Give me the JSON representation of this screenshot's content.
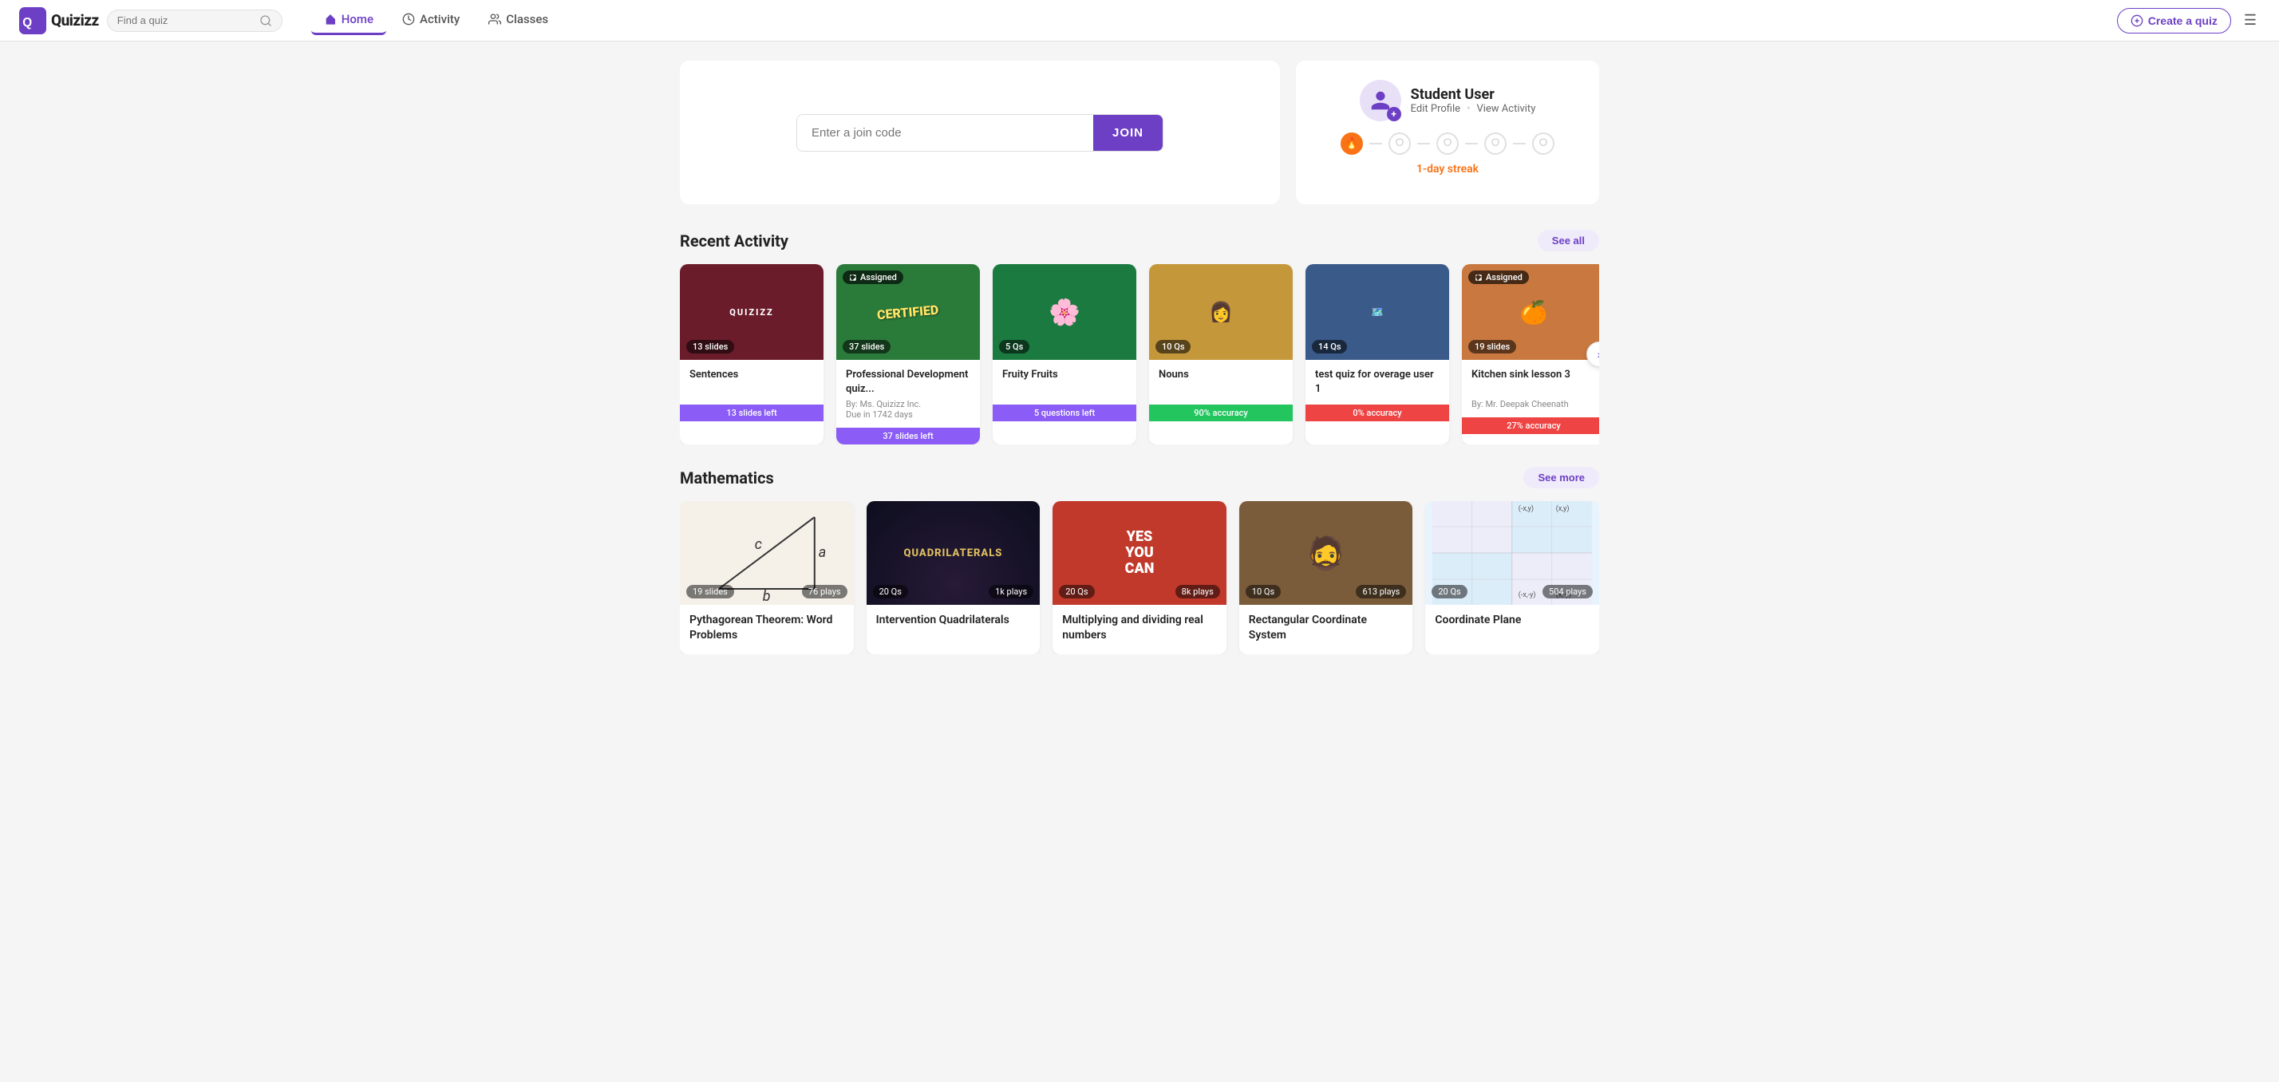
{
  "nav": {
    "logo": "Quizizz",
    "search_placeholder": "Find a quiz",
    "links": [
      {
        "id": "home",
        "label": "Home",
        "active": true,
        "icon": "home"
      },
      {
        "id": "activity",
        "label": "Activity",
        "active": false,
        "icon": "clock"
      },
      {
        "id": "classes",
        "label": "Classes",
        "active": false,
        "icon": "users"
      }
    ],
    "create_label": "Create a quiz",
    "menu_icon": "☰"
  },
  "hero": {
    "join_placeholder": "Enter a join code",
    "join_btn": "JOIN",
    "profile": {
      "name": "Student User",
      "edit_label": "Edit Profile",
      "view_label": "View Activity",
      "streak_label": "1-day streak",
      "streak_days": [
        true,
        false,
        false,
        false,
        false,
        false
      ]
    }
  },
  "recent_activity": {
    "title": "Recent Activity",
    "see_all": "See all",
    "cards": [
      {
        "id": "sentences",
        "title": "Sentences",
        "badge_left": "13 slides",
        "bg_color": "#6b1c2b",
        "text_color": "#fff",
        "logo_text": "Quizizz",
        "status_label": "13 slides left",
        "status_type": "purple"
      },
      {
        "id": "professional",
        "title": "Professional Development quiz...",
        "badge_left": "37 slides",
        "bg_color": "#2d7a3a",
        "text_color": "#fff",
        "assigned": true,
        "by": "By: Ms. Quizizz Inc.",
        "due": "Due in 1742 days",
        "status_label": "37 slides left",
        "status_type": "purple"
      },
      {
        "id": "fruity",
        "title": "Fruity Fruits",
        "badge_left": "5 Qs",
        "bg_color": "#1a7a40",
        "text_color": "#fff",
        "status_label": "5 questions left",
        "status_type": "purple"
      },
      {
        "id": "nouns",
        "title": "Nouns",
        "badge_left": "10 Qs",
        "bg_color": "#8a6a2e",
        "text_color": "#fff",
        "status_label": "90% accuracy",
        "status_type": "green"
      },
      {
        "id": "test-quiz",
        "title": "test quiz for overage user 1",
        "badge_left": "14 Qs",
        "bg_color": "#3a5a7a",
        "text_color": "#fff",
        "status_label": "0% accuracy",
        "status_type": "red"
      },
      {
        "id": "kitchen",
        "title": "Kitchen sink lesson 3",
        "badge_left": "19 slides",
        "bg_color": "#b85c1a",
        "text_color": "#fff",
        "assigned": true,
        "by": "By: Mr. Deepak Cheenath",
        "status_label": "27% accuracy",
        "status_type": "red"
      }
    ]
  },
  "mathematics": {
    "title": "Mathematics",
    "see_more": "See more",
    "cards": [
      {
        "id": "pythagorean",
        "title": "Pythagorean Theorem: Word Problems",
        "badge_left": "19 slides",
        "badge_right": "76 plays",
        "bg": "pyth",
        "bg_color": "#f5f0e8"
      },
      {
        "id": "quadrilaterals",
        "title": "Intervention Quadrilaterals",
        "badge_left": "20 Qs",
        "badge_right": "1k plays",
        "bg": "quad",
        "bg_color": "#1a1a2e"
      },
      {
        "id": "multiplying",
        "title": "Multiplying and dividing real numbers",
        "badge_left": "20 Qs",
        "badge_right": "8k plays",
        "bg": "mult",
        "bg_color": "#c0392b"
      },
      {
        "id": "rectangular",
        "title": "Rectangular Coordinate System",
        "badge_left": "10 Qs",
        "badge_right": "613 plays",
        "plays_full": "613 plays",
        "bg": "rect",
        "bg_color": "#7a5c3a"
      },
      {
        "id": "coordinate",
        "title": "Coordinate Plane",
        "badge_left": "20 Qs",
        "badge_right": "504 plays",
        "plays_full": "504 plays",
        "bg": "coord",
        "bg_color": "#e8f4fd"
      }
    ]
  }
}
